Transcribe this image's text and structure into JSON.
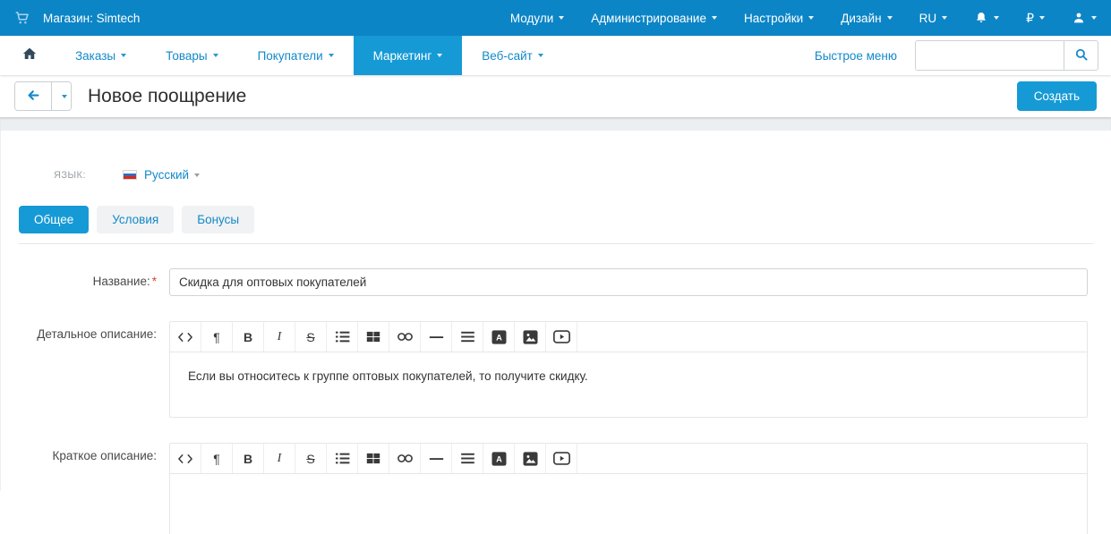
{
  "topbar": {
    "store_label": "Магазин: Simtech",
    "menus": [
      {
        "label": "Модули"
      },
      {
        "label": "Администрирование"
      },
      {
        "label": "Настройки"
      },
      {
        "label": "Дизайн"
      },
      {
        "label": "RU"
      }
    ],
    "currency_symbol": "₽"
  },
  "navbar": {
    "items": [
      {
        "label": "Заказы",
        "active": false
      },
      {
        "label": "Товары",
        "active": false
      },
      {
        "label": "Покупатели",
        "active": false
      },
      {
        "label": "Маркетинг",
        "active": true
      },
      {
        "label": "Веб-сайт",
        "active": false
      }
    ],
    "quick_menu_label": "Быстрое меню",
    "search_value": ""
  },
  "header": {
    "title": "Новое поощрение",
    "create_button_label": "Создать"
  },
  "language": {
    "label": "ЯЗЫК:",
    "value": "Русский",
    "flag": "russia-flag-icon"
  },
  "tabs": [
    {
      "label": "Общее",
      "active": true
    },
    {
      "label": "Условия",
      "active": false
    },
    {
      "label": "Бонусы",
      "active": false
    }
  ],
  "form": {
    "name": {
      "label": "Название:",
      "required_mark": "*",
      "value": "Скидка для оптовых покупателей"
    },
    "full_description": {
      "label": "Детальное описание:",
      "value": "Если вы относитесь к группе оптовых покупателей, то получите скидку."
    },
    "short_description": {
      "label": "Краткое описание:",
      "value": ""
    }
  },
  "editor": {
    "toolbar_icons": [
      "code-view",
      "paragraph",
      "bold",
      "italic",
      "strikethrough",
      "unordered-list",
      "table-grid",
      "link",
      "horizontal-rule",
      "align",
      "font-color",
      "image",
      "video"
    ]
  },
  "colors": {
    "topbar_blue": "#0c85c6",
    "accent_blue": "#169ad6",
    "link_blue": "#1289ca",
    "required_red": "#e0402f"
  }
}
